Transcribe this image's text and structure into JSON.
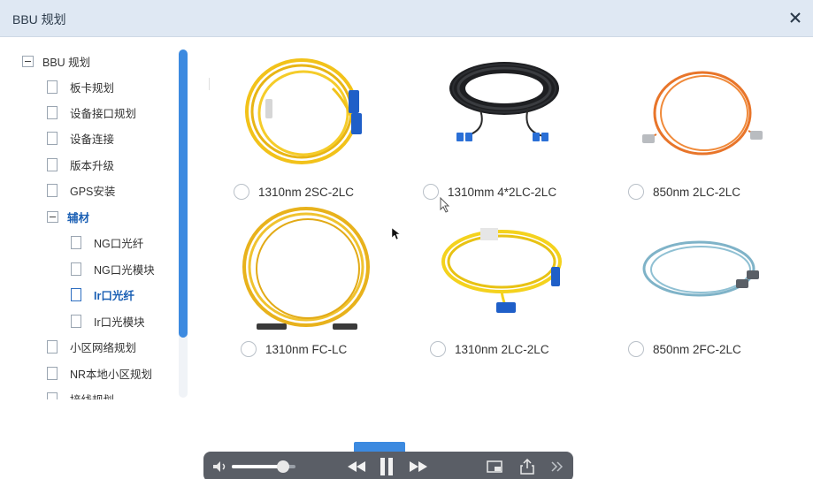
{
  "window": {
    "title": "BBU 规划"
  },
  "tree": {
    "root": {
      "label": "BBU 规划"
    },
    "items": [
      {
        "label": "板卡规划"
      },
      {
        "label": "设备接口规划"
      },
      {
        "label": "设备连接"
      },
      {
        "label": "版本升级"
      },
      {
        "label": "GPS安装"
      }
    ],
    "group": {
      "label": "辅材",
      "children": [
        {
          "label": "NG口光纤"
        },
        {
          "label": "NG口光模块"
        },
        {
          "label": "Ir口光纤",
          "selected": true
        },
        {
          "label": "Ir口光模块"
        }
      ]
    },
    "items_after": [
      {
        "label": "小区网络规划"
      },
      {
        "label": "NR本地小区规划"
      }
    ],
    "partial_label": "接线规划"
  },
  "options": [
    {
      "label": "1310nm 2SC-2LC",
      "cable_color": "#f2c21a",
      "connector_color": "#1f5fc8"
    },
    {
      "label": "1310mm 4*2LC-2LC",
      "cable_color": "#1e1f22",
      "connector_color": "#2a6fd6"
    },
    {
      "label": "850nm 2LC-2LC",
      "cable_color": "#e8752a",
      "connector_color": "#b9bcc0"
    },
    {
      "label": "1310nm FC-LC",
      "cable_color": "#e8b21c",
      "connector_color": "#3a3a3a"
    },
    {
      "label": "1310nm 2LC-2LC",
      "cable_color": "#f4d21e",
      "connector_color": "#1f5fc8"
    },
    {
      "label": "850nm 2FC-2LC",
      "cable_color": "#7fb3c8",
      "connector_color": "#5a5f66"
    }
  ],
  "player": {
    "volume_fraction": 0.8
  },
  "colors": {
    "accent": "#3c8ae0",
    "titlebar": "#dfe8f3"
  }
}
